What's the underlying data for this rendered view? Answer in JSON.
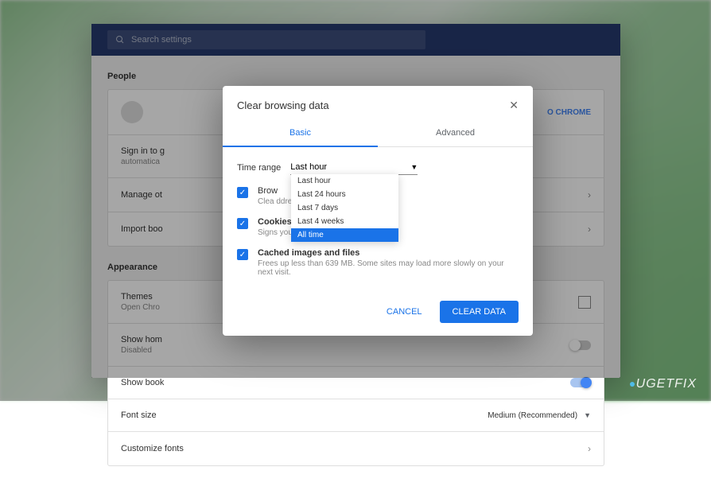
{
  "header": {
    "search_placeholder": "Search settings"
  },
  "sections": {
    "people": {
      "title": "People",
      "signin_desc": "Sign in to g",
      "signin_sub": "automatica",
      "signin_link": "O CHROME",
      "manage": "Manage ot",
      "import": "Import boo"
    },
    "appearance": {
      "title": "Appearance",
      "themes": "Themes",
      "themes_sub": "Open Chro",
      "show_home": "Show hom",
      "show_home_sub": "Disabled",
      "show_book": "Show book",
      "font_size": "Font size",
      "font_size_val": "Medium (Recommended)",
      "customize": "Customize fonts"
    }
  },
  "dialog": {
    "title": "Clear browsing data",
    "tabs": {
      "basic": "Basic",
      "advanced": "Advanced"
    },
    "time_range_label": "Time range",
    "time_range_value": "Last hour",
    "dropdown_options": [
      "Last hour",
      "Last 24 hours",
      "Last 7 days",
      "Last 4 weeks",
      "All time"
    ],
    "items": [
      {
        "title": "Brow",
        "desc": "Clea                                                                ddress bar."
      },
      {
        "title": "Cookies and other site data",
        "desc": "Signs you out of most sites."
      },
      {
        "title": "Cached images and files",
        "desc": "Frees up less than 639 MB. Some sites may load more slowly on your next visit."
      }
    ],
    "cancel": "CANCEL",
    "clear": "CLEAR DATA"
  },
  "watermark": "UGETFIX"
}
